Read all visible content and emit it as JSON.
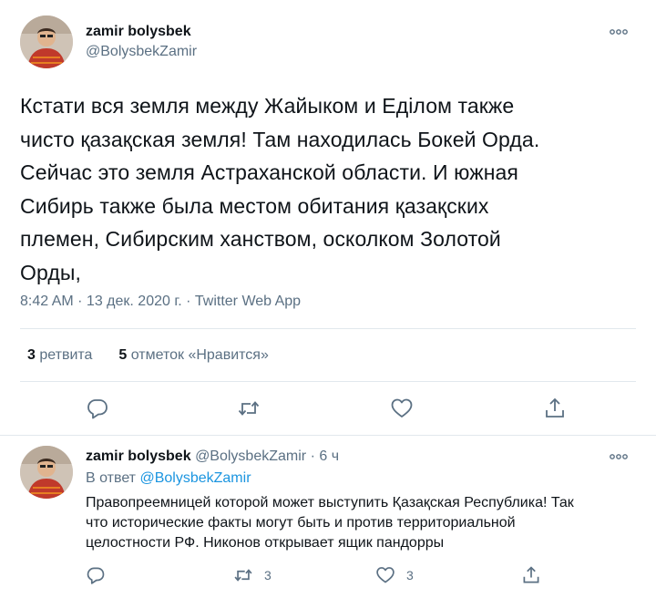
{
  "main_tweet": {
    "author_name": "zamir bolysbek",
    "author_handle": "@BolysbekZamir",
    "text_lines": [
      "Кстати вся земля между Жайыком и Еділом также",
      "чисто қазақская земля! Там находилась Бокей Орда.",
      "Сейчас это земля Астраханской области. И южная",
      "Сибирь также была местом обитания қазақских",
      "племен, Сибирским ханством, осколком Золотой",
      "Орды,"
    ],
    "meta": "8:42 AM · 13 дек. 2020 г. · Twitter Web App",
    "retweets_count": "3",
    "retweets_label": "ретвита",
    "likes_count": "5",
    "likes_label": "отметок «Нравится»"
  },
  "reply_tweet": {
    "author_name": "zamir bolysbek",
    "author_handle": "@BolysbekZamir",
    "separator": "·",
    "time": "6 ч",
    "reply_prefix": "В ответ",
    "reply_mention": "@BolysbekZamir",
    "text_lines": [
      "Правопреемницей которой может выступить Қазақская Республика! Так",
      "что исторические факты могут быть и против территориальной",
      "целостности РФ. Никонов открывает ящик пандорры"
    ],
    "retweet_count": "3",
    "like_count": "3"
  },
  "colors": {
    "text": "#0f1419",
    "secondary": "#5b7083",
    "link": "#1b95e0",
    "border": "#e1e8ed"
  },
  "icons": [
    "more-icon",
    "reply-icon",
    "retweet-icon",
    "like-icon",
    "share-icon"
  ]
}
